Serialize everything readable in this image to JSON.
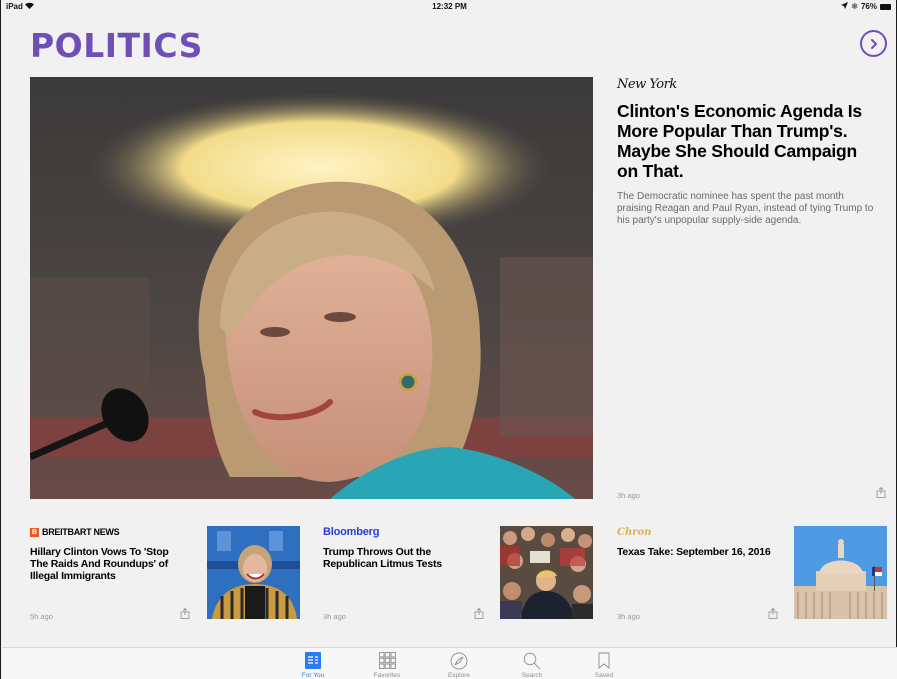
{
  "status_bar": {
    "device": "iPad",
    "time": "12:32 PM",
    "battery": "76%"
  },
  "header": {
    "title": "POLITICS"
  },
  "hero": {
    "source": "New York",
    "headline": "Clinton's Economic Agenda Is More Popular Than Trump's. Maybe She Should Campaign on That.",
    "summary": "The Democratic nominee has spent the past month praising Reagan and Paul Ryan, instead of tying Trump to his party's unpopular supply-side agenda.",
    "time": "3h ago"
  },
  "cards": [
    {
      "source_badge": "B",
      "source": "BREITBART NEWS",
      "headline": "Hillary Clinton Vows To 'Stop The Raids And Roundups' of Illegal Immigrants",
      "time": "5h ago"
    },
    {
      "source": "Bloomberg",
      "headline": "Trump Throws Out the Republican Litmus Tests",
      "time": "3h ago"
    },
    {
      "source": "Chron",
      "headline": "Texas Take: September 16, 2016",
      "time": "3h ago"
    }
  ],
  "tabbar": {
    "tabs": [
      {
        "label": "For You",
        "icon": "for-you-icon",
        "active": true
      },
      {
        "label": "Favorites",
        "icon": "favorites-grid-icon",
        "active": false
      },
      {
        "label": "Explore",
        "icon": "compass-icon",
        "active": false
      },
      {
        "label": "Search",
        "icon": "search-icon",
        "active": false
      },
      {
        "label": "Saved",
        "icon": "bookmark-icon",
        "active": false
      }
    ]
  },
  "colors": {
    "accent": "#6f4fb6",
    "tab_active": "#2b7cf3",
    "bloomberg": "#2b3bd6",
    "breitbart": "#e35b21",
    "chron": "#d7b35a"
  }
}
